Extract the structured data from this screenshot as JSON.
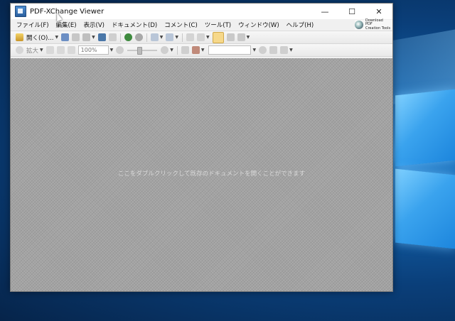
{
  "window": {
    "title": "PDF-XChange Viewer",
    "controls": {
      "minimize": "—",
      "maximize": "☐",
      "close": "✕"
    }
  },
  "menubar": {
    "items": [
      {
        "label": "ファイル(F)"
      },
      {
        "label": "編集(E)"
      },
      {
        "label": "表示(V)"
      },
      {
        "label": "ドキュメント(D)"
      },
      {
        "label": "コメント(C)"
      },
      {
        "label": "ツール(T)"
      },
      {
        "label": "ウィンドウ(W)"
      },
      {
        "label": "ヘルプ(H)"
      }
    ],
    "promo": {
      "line1": "Download PDF",
      "line2": "Creation Tools"
    }
  },
  "toolbar1": {
    "open_label": "開く(O)...",
    "icons": [
      "open-folder-icon",
      "save-icon",
      "print-icon",
      "scan-icon",
      "email-icon",
      "find-icon",
      "back-icon",
      "forward-icon",
      "undo-icon",
      "redo-icon",
      "hand-tool-icon",
      "rotate-left-icon",
      "rotate-right-icon",
      "highlight-icon",
      "snapshot-icon",
      "copy-icon"
    ]
  },
  "toolbar2": {
    "zoom_tool_label": "拡大",
    "zoom_value": "100%",
    "find_placeholder": ""
  },
  "workspace": {
    "hint": "ここをダブルクリックして既存のドキュメントを開くことができます"
  },
  "colors": {
    "desktop_bg": "#0b4f8f",
    "window_bg": "#f0f0f0",
    "workspace_bg": "#a3a3a3",
    "accent_highlight": "#f6d88a"
  }
}
